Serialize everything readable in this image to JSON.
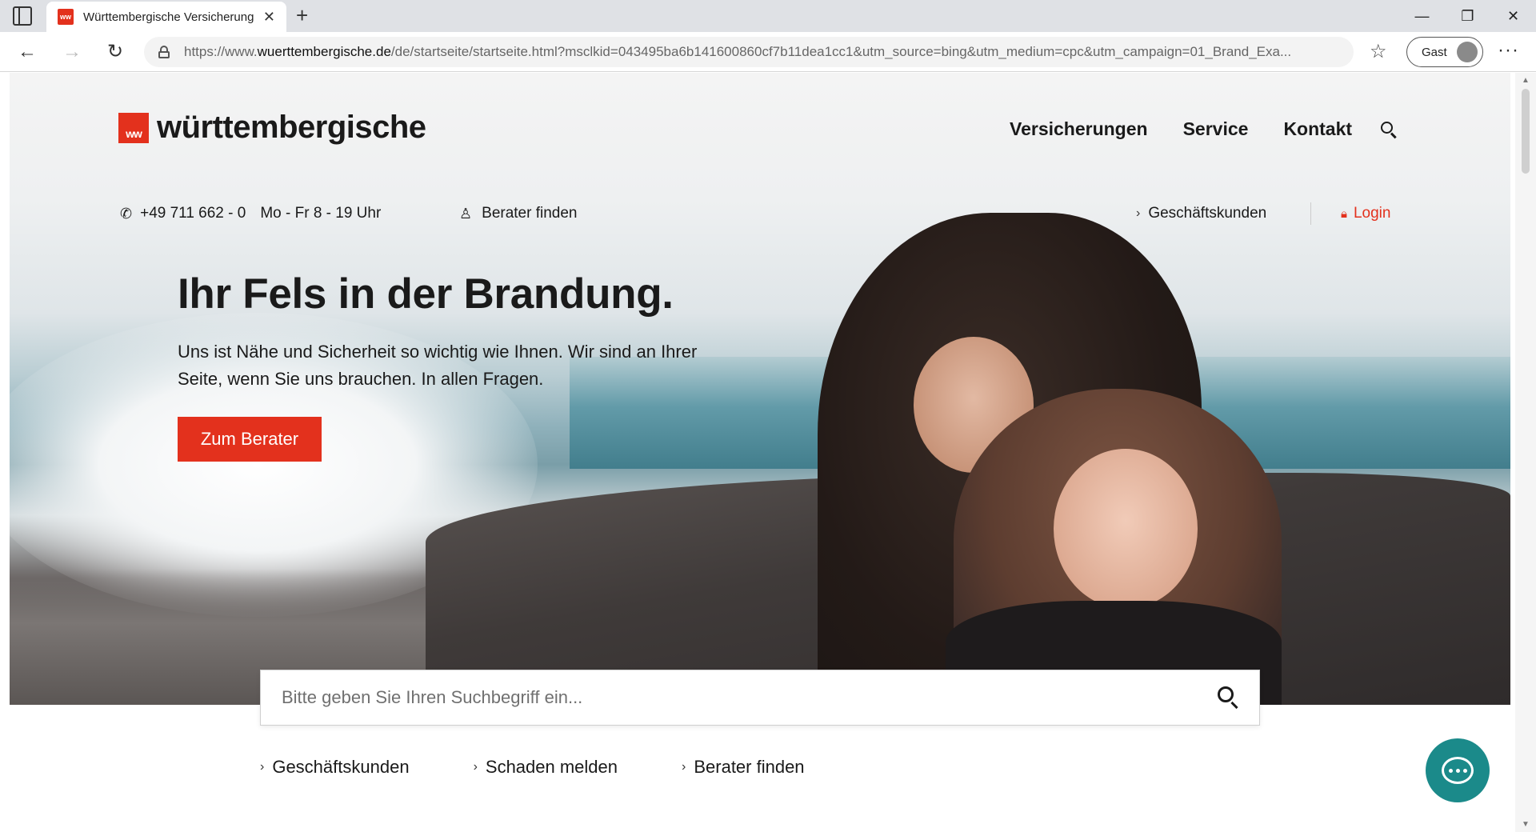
{
  "browser": {
    "tab_title": "Württembergische Versicherung",
    "tab_close": "✕",
    "new_tab": "+",
    "favicon_text": "ww",
    "url_prefix": "https://www.",
    "url_domain": "wuerttembergische.de",
    "url_rest": "/de/startseite/startseite.html?msclkid=043495ba6b141600860cf7b11dea1cc1&utm_source=bing&utm_medium=cpc&utm_campaign=01_Brand_Exa...",
    "profile_label": "Gast",
    "back": "←",
    "forward": "→",
    "reload": "↻",
    "favorites": "☆",
    "more": "···",
    "minimize": "—",
    "restore": "❐",
    "close": "✕"
  },
  "header": {
    "logo_mark": "ww",
    "logo_text": "württembergische",
    "nav": [
      "Versicherungen",
      "Service",
      "Kontakt"
    ]
  },
  "service_bar": {
    "phone": "+49 711 662 - 0",
    "hours": "Mo - Fr 8 - 19 Uhr",
    "berater": "Berater finden",
    "geschaeftskunden": "Geschäftskunden",
    "login": "Login"
  },
  "hero": {
    "title": "Ihr Fels in der Brandung.",
    "subtitle": "Uns ist Nähe und Sicherheit so wichtig wie Ihnen. Wir sind an Ihrer Seite, wenn Sie uns brauchen. In allen Fragen.",
    "cta": "Zum Berater"
  },
  "search": {
    "placeholder": "Bitte geben Sie Ihren Suchbegriff ein..."
  },
  "quick_links": [
    "Geschäftskunden",
    "Schaden melden",
    "Berater finden"
  ],
  "colors": {
    "brand_red": "#e3311d",
    "chat_teal": "#1b8a8a"
  },
  "icons": {
    "phone": "phone-icon",
    "person": "person-icon",
    "lock": "lock-icon",
    "search": "search-icon",
    "chat": "chat-icon"
  }
}
